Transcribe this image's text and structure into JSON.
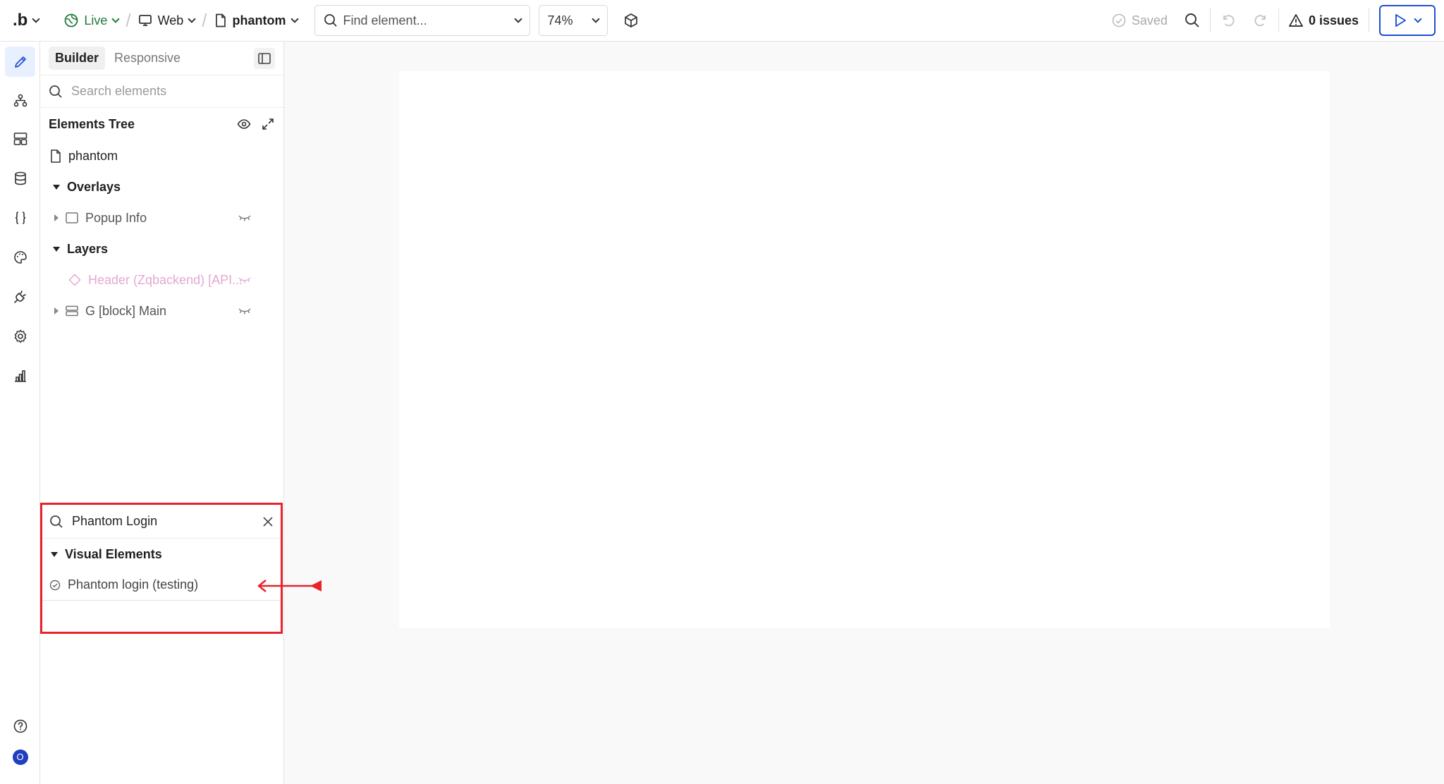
{
  "topbar": {
    "logo": ".b",
    "status": "Live",
    "platform": "Web",
    "page_name": "phantom",
    "find_placeholder": "Find element...",
    "zoom": "74%",
    "saved_label": "Saved",
    "issues_label": "0 issues"
  },
  "panel": {
    "tabs": [
      "Builder",
      "Responsive"
    ],
    "search_placeholder": "Search elements",
    "tree_title": "Elements Tree",
    "tree": {
      "page": "phantom",
      "overlays": "Overlays",
      "popup": "Popup Info",
      "layers": "Layers",
      "header": "Header (Zqbackend) [API...",
      "main": "G [block] Main"
    }
  },
  "results": {
    "query": "Phantom Login",
    "group": "Visual Elements",
    "item": "Phantom login (testing)"
  },
  "rail": {
    "avatar_initial": "O"
  },
  "colors": {
    "accent": "#1f50d1",
    "live": "#1f7a3a",
    "highlight": "#e8232a",
    "hidden_element": "#e4a9d2"
  }
}
